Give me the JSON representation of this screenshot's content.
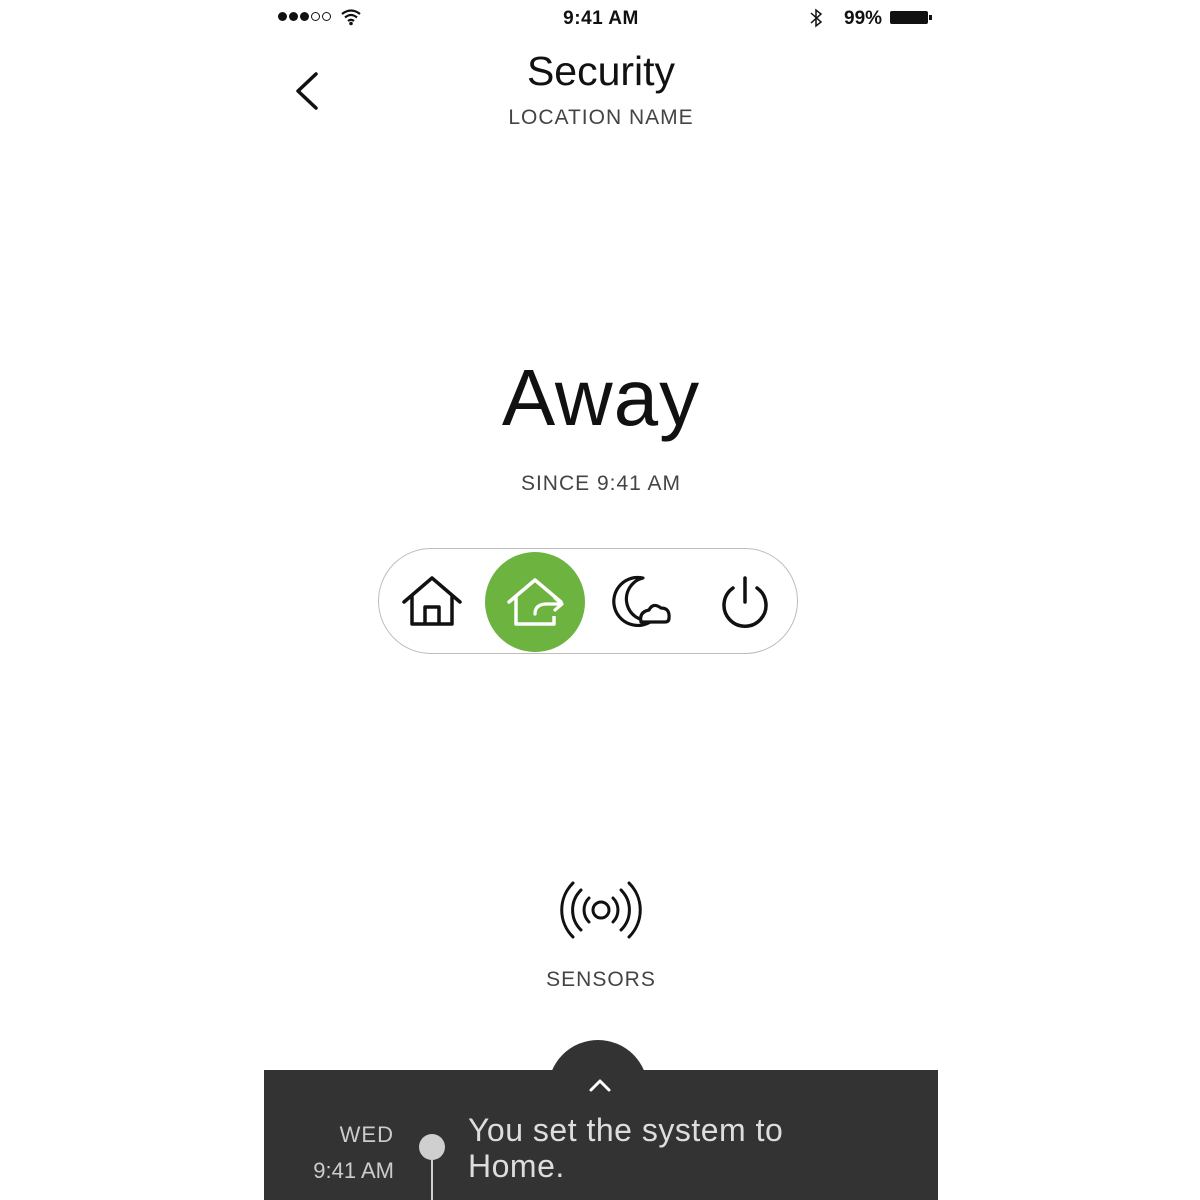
{
  "status_bar": {
    "time": "9:41 AM",
    "battery_percent": "99%",
    "signal_bars_filled": 3,
    "signal_bars_total": 5,
    "icons": [
      "signal-icon",
      "wifi-icon",
      "bluetooth-icon",
      "battery-icon"
    ]
  },
  "header": {
    "title": "Security",
    "subtitle": "LOCATION NAME",
    "back_icon": "back-chevron-icon"
  },
  "mode": {
    "current": "Away",
    "since": "SINCE 9:41 AM",
    "options": [
      {
        "id": "home",
        "icon": "home-icon",
        "selected": false
      },
      {
        "id": "away",
        "icon": "away-icon",
        "selected": true
      },
      {
        "id": "night",
        "icon": "night-icon",
        "selected": false
      },
      {
        "id": "off",
        "icon": "power-icon",
        "selected": false
      }
    ],
    "accent_color": "#6db33f"
  },
  "sensors": {
    "label": "SENSORS",
    "icon": "sensors-icon"
  },
  "activity": {
    "day": "WED",
    "time": "9:41 AM",
    "message": "You set the system to Home.",
    "expand_icon": "chevron-up-icon",
    "panel_color": "#333333"
  }
}
